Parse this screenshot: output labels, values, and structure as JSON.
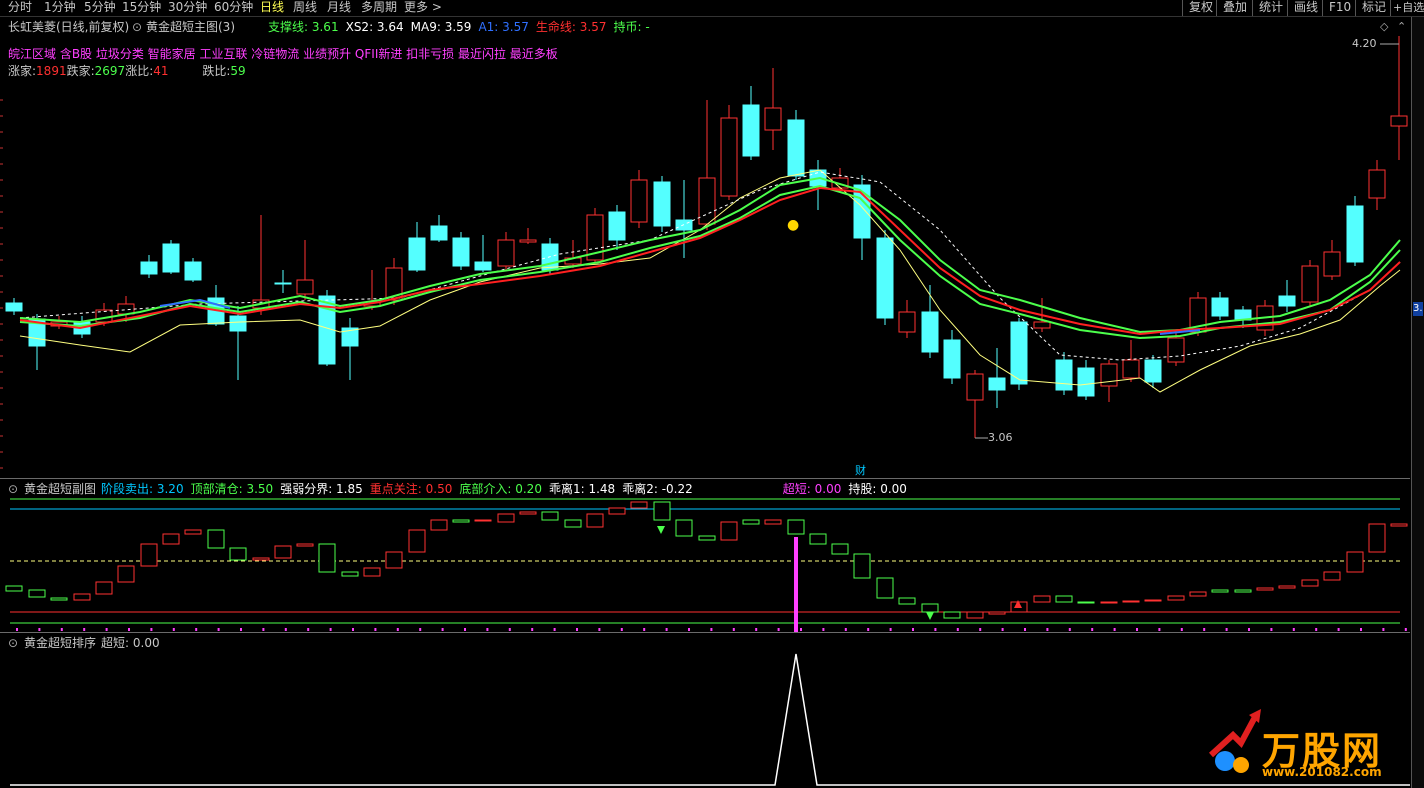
{
  "toolbar": {
    "periods": [
      "分时",
      "1分钟",
      "5分钟",
      "15分钟",
      "30分钟",
      "60分钟",
      "日线",
      "周线",
      "月线",
      "多周期",
      "更多 >"
    ],
    "active_period": "日线",
    "right_buttons": [
      "复权",
      "叠加",
      "统计",
      "画线",
      "F10",
      "标记",
      "+自选"
    ]
  },
  "main": {
    "stock_title": "长虹美菱(日线,前复权)",
    "indicator_name": "黄金超短主图(3)",
    "indicators": [
      {
        "label": "支撑线:",
        "value": "3.61",
        "color": "#4cff4c"
      },
      {
        "label": "XS2:",
        "value": "3.64",
        "color": "#ffffff"
      },
      {
        "label": "MA9:",
        "value": "3.59",
        "color": "#ffffff"
      },
      {
        "label": "A1:",
        "value": "3.57",
        "color": "#3070ff"
      },
      {
        "label": "生命线:",
        "value": "3.57",
        "color": "#ff3030"
      },
      {
        "label": "持币:",
        "value": "-",
        "color": "#4cff4c"
      }
    ],
    "concepts": "皖江区域 含B股 垃圾分类 智能家居 工业互联 冷链物流 业绩预升 QFII新进 扣非亏损 最近闪拉 最近多板",
    "rise_label": "涨家:",
    "rise_value": "1891",
    "fall_label": "跌家:",
    "fall_value": "2697",
    "rise_ratio_label": "涨比:",
    "rise_ratio_value": "41",
    "fall_ratio_label": "跌比:",
    "fall_ratio_value": "59",
    "high_label": "4.20",
    "low_label": "3.06",
    "cai_marker": "财",
    "right_edge_price": "3."
  },
  "sub": {
    "indicator_name": "黄金超短副图",
    "values": [
      {
        "label": "阶段卖出:",
        "value": "3.20",
        "color": "#00c8ff"
      },
      {
        "label": "顶部清仓:",
        "value": "3.50",
        "color": "#4cff4c"
      },
      {
        "label": "强弱分界:",
        "value": "1.85",
        "color": "#ffffff"
      },
      {
        "label": "重点关注:",
        "value": "0.50",
        "color": "#ff3030"
      },
      {
        "label": "底部介入:",
        "value": "0.20",
        "color": "#4cff4c"
      },
      {
        "label": "乖离1:",
        "value": "1.48",
        "color": "#ffffff"
      },
      {
        "label": "乖离2:",
        "value": "-0.22",
        "color": "#ffffff"
      },
      {
        "label": "超短:",
        "value": "0.00",
        "color": "#ff40ff"
      },
      {
        "label": "持股:",
        "value": "0.00",
        "color": "#ffffff"
      }
    ]
  },
  "rank": {
    "indicator_name": "黄金超短排序",
    "label": "超短:",
    "value": "0.00"
  },
  "watermark": {
    "brand": "万股网",
    "url": "www.201082.com"
  },
  "colors": {
    "up": "#ff3232",
    "down": "#54ffff",
    "ma_green": "#4cff4c",
    "ma_red": "#ff2020",
    "ma_yellow": "#ffff80"
  }
}
